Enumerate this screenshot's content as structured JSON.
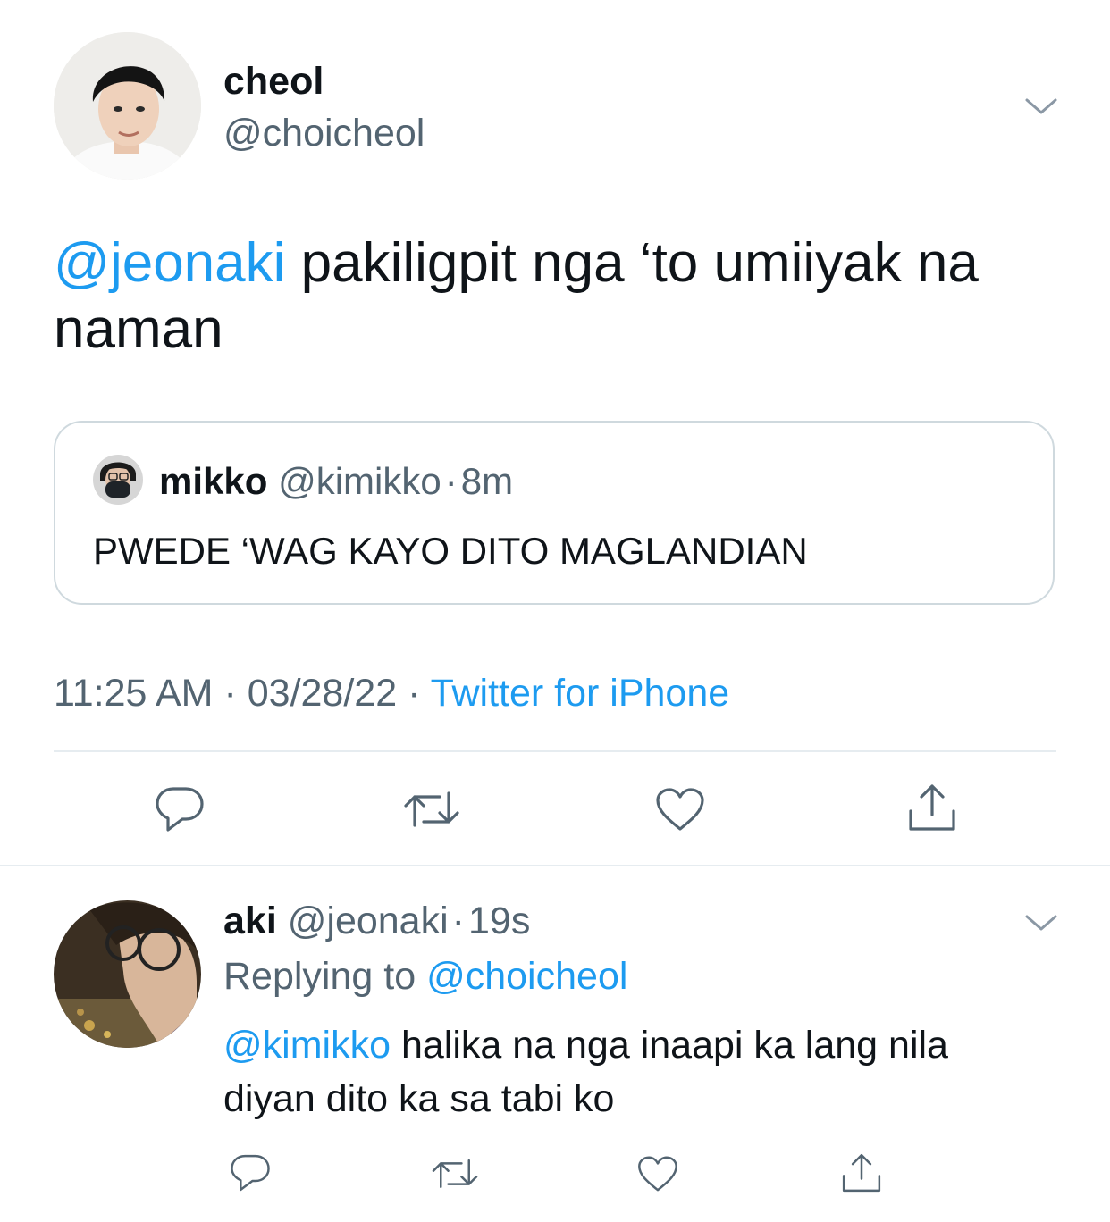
{
  "tweet": {
    "author": {
      "name": "cheol",
      "handle": "@choicheol"
    },
    "text": {
      "mention": "@jeonaki",
      "line1_rest": " pakiligpit nga ‘to umiiyak na",
      "line2": "naman"
    },
    "quote": {
      "name": "mikko",
      "handle": "@kimikko",
      "separator": "·",
      "time": "8m",
      "text": "PWEDE ‘WAG KAYO DITO MAGLANDIAN"
    },
    "meta": {
      "time": "11:25 AM",
      "sep1": "·",
      "date": "03/28/22",
      "sep2": "·",
      "source": "Twitter for iPhone"
    }
  },
  "reply": {
    "name": "aki",
    "handle": "@jeonaki",
    "separator": "·",
    "time": "19s",
    "replying_prefix": "Replying to ",
    "replying_handle": "@choicheol",
    "text": {
      "mention": "@kimikko",
      "line1_rest": " halika na nga inaapi ka lang nila",
      "line2": "diyan dito ka sa tabi ko"
    }
  },
  "icons": [
    "chevron-down-icon",
    "reply-icon",
    "retweet-icon",
    "like-icon",
    "share-icon"
  ],
  "colors": {
    "link": "#1d9bf0",
    "muted": "#536471",
    "divider": "#cfd9de",
    "text": "#0f1419"
  }
}
